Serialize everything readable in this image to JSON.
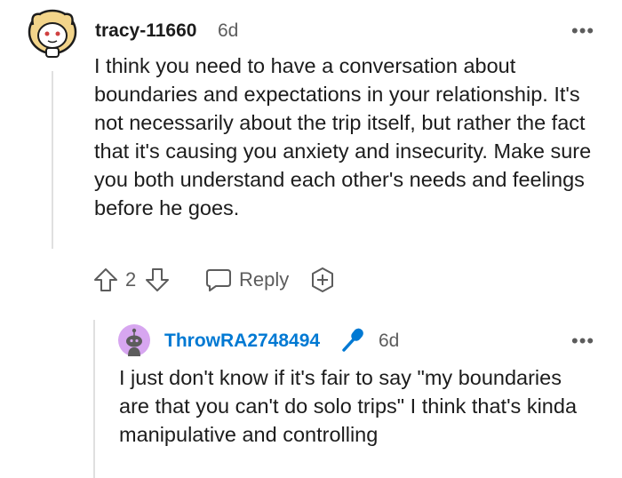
{
  "comment": {
    "username": "tracy-11660",
    "age": "6d",
    "body": "I think you need to have a conversation about boundaries and expectations in your relationship. It's not necessarily about the trip itself, but rather the fact that it's causing you anxiety and insecurity. Make sure you both understand each other's needs and feelings before he goes.",
    "vote_count": "2",
    "reply_label": "Reply",
    "more_label": "•••",
    "icons": {
      "avatar": "snoo-avatar-icon",
      "upvote": "arrow-up-icon",
      "downvote": "arrow-down-icon",
      "reply": "speech-bubble-icon",
      "award": "plus-award-icon"
    }
  },
  "reply": {
    "username": "ThrowRA2748494",
    "age": "6d",
    "body": "I just don't know if it's fair to say \"my boundaries are that you can't do solo trips\" I think that's kinda manipulative and controlling",
    "more_label": "•••",
    "icons": {
      "avatar": "snoo-avatar-icon",
      "op_badge": "microphone-icon"
    }
  },
  "colors": {
    "link_blue": "#0079d3",
    "text": "#1c1c1c",
    "meta": "#5c5c5c",
    "reply_avatar_bg": "#d7a6f0",
    "thread_line": "#e0e0e0"
  }
}
